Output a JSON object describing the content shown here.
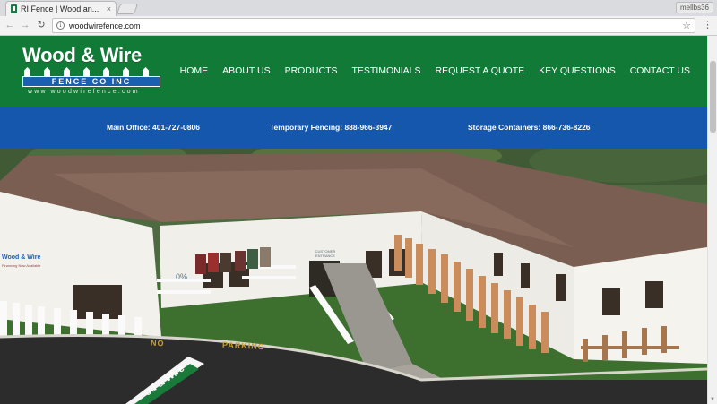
{
  "browser": {
    "tab_title": "RI Fence | Wood an...",
    "tab_close": "×",
    "profile_label": "mellbs36",
    "url": "woodwirefence.com",
    "back_icon": "←",
    "forward_icon": "→",
    "reload_icon": "↻",
    "star_icon": "☆",
    "menu_icon": "⋮",
    "info_icon": "i"
  },
  "site": {
    "logo": {
      "title": "Wood & Wire",
      "band": "FENCE CO INC",
      "url": "www.woodwirefence.com"
    },
    "nav": [
      "HOME",
      "ABOUT US",
      "PRODUCTS",
      "TESTIMONIALS",
      "REQUEST A QUOTE",
      "KEY QUESTIONS",
      "CONTACT US"
    ],
    "info_bar": {
      "main_office": "Main Office: 401-727-0806",
      "temporary_fencing": "Temporary Fencing: 888-966-3947",
      "storage_containers": "Storage Containers: 866-736-8226"
    },
    "hero": {
      "pavement_text_1": "NO",
      "pavement_text_2": "PARKING",
      "building_sign": "Wood & Wire",
      "building_sign_sub": "Financing Now Available",
      "window_promo": "0%",
      "entrance_sign": "CUSTOMER ENTRANCE",
      "yard_sign": "od & Wire"
    }
  },
  "colors": {
    "header_green": "#127a37",
    "info_blue": "#1457ad"
  }
}
